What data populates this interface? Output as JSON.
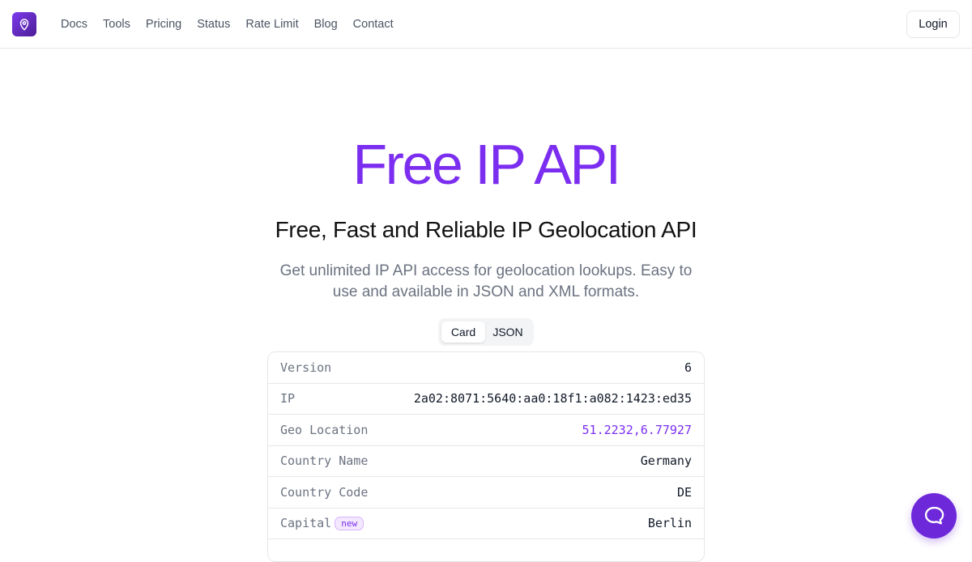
{
  "header": {
    "nav": [
      "Docs",
      "Tools",
      "Pricing",
      "Status",
      "Rate Limit",
      "Blog",
      "Contact"
    ],
    "login_label": "Login"
  },
  "hero": {
    "title": "Free IP API",
    "subtitle": "Free, Fast and Reliable IP Geolocation API",
    "description": "Get unlimited IP API access for geolocation lookups. Easy to use and available in JSON and XML formats."
  },
  "view_toggle": {
    "options": [
      "Card",
      "JSON"
    ],
    "selected": "Card"
  },
  "result_card": {
    "rows": [
      {
        "key": "Version",
        "value": "6"
      },
      {
        "key": "IP",
        "value": "2a02:8071:5640:aa0:18f1:a082:1423:ed35"
      },
      {
        "key": "Geo Location",
        "value": "51.2232,6.77927"
      },
      {
        "key": "Country Name",
        "value": "Germany"
      },
      {
        "key": "Country Code",
        "value": "DE"
      },
      {
        "key": "Capital",
        "value": "Berlin",
        "badge": "new"
      }
    ]
  },
  "colors": {
    "accent": "#7c2ef0",
    "chat_button": "#6d28d9"
  },
  "icons": {
    "logo": "map-pin-icon",
    "chat": "chat-bubble-icon"
  }
}
